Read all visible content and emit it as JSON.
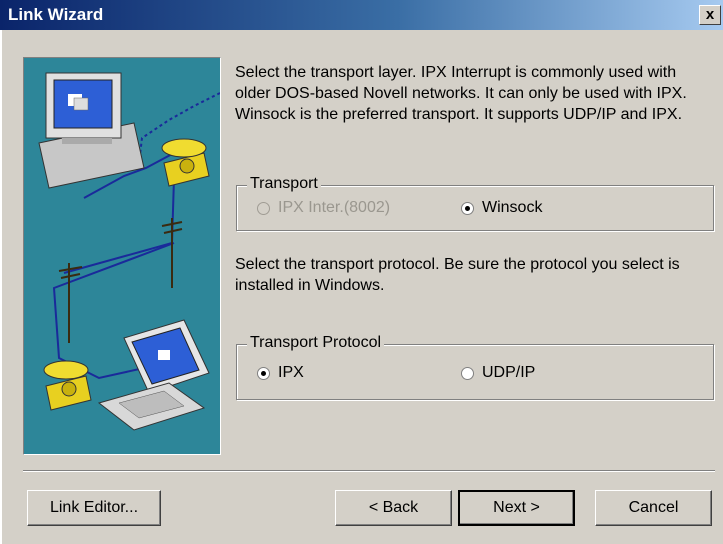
{
  "window": {
    "title": "Link Wizard",
    "close_label": "x"
  },
  "intro_text": "Select the transport layer. IPX Interrupt is commonly used with older DOS-based Novell networks. It can only be used with IPX. Winsock is the preferred transport. It supports UDP/IP and IPX.",
  "transport_group": {
    "label": "Transport",
    "options": [
      {
        "label": "IPX Inter.(8002)",
        "checked": false,
        "disabled": true
      },
      {
        "label": "Winsock",
        "checked": true,
        "disabled": false
      }
    ]
  },
  "protocol_text": "Select the transport protocol. Be sure the protocol you select is installed in Windows.",
  "protocol_group": {
    "label": "Transport Protocol",
    "options": [
      {
        "label": "IPX",
        "checked": true,
        "disabled": false
      },
      {
        "label": "UDP/IP",
        "checked": false,
        "disabled": false
      }
    ]
  },
  "buttons": {
    "link_editor": "Link Editor...",
    "back": "< Back",
    "next": "Next >",
    "cancel": "Cancel"
  },
  "colors": {
    "illustration_bg": "#2d8699",
    "title_bar": "#0a246a",
    "dialog_face": "#d4d0c8"
  }
}
